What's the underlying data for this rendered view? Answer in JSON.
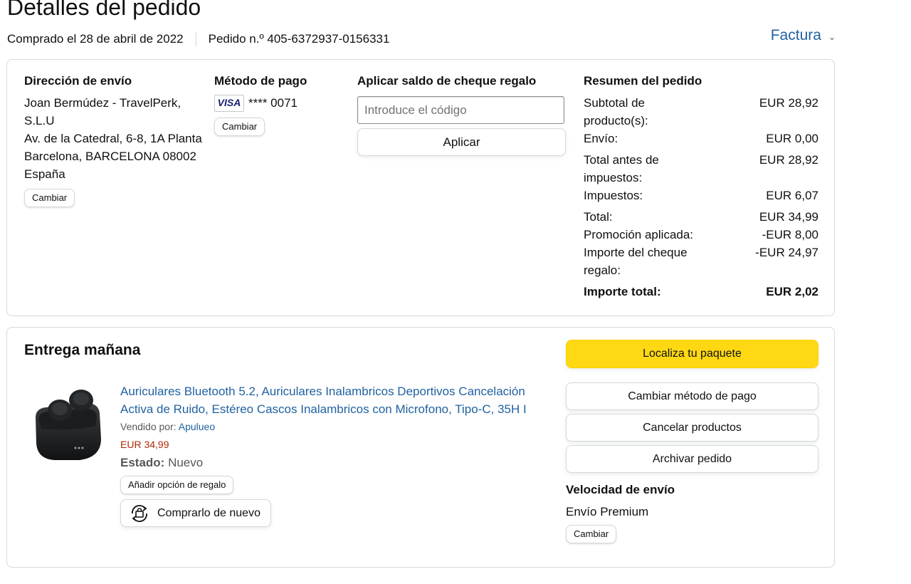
{
  "page": {
    "title": "Detalles del pedido"
  },
  "meta": {
    "purchased": "Comprado el 28 de abril de 2022",
    "order_number": "Pedido n.º 405-6372937-0156331",
    "invoice_label": "Factura"
  },
  "shipping": {
    "title": "Dirección de envío",
    "lines": [
      "Joan Bermúdez - TravelPerk, S.L.U",
      "Av. de la Catedral, 6-8, 1A Planta",
      "Barcelona, BARCELONA 08002",
      "España"
    ],
    "change_label": "Cambiar"
  },
  "payment": {
    "title": "Método de pago",
    "card_brand": "VISA",
    "card_masked": "**** 0071",
    "change_label": "Cambiar"
  },
  "gift": {
    "title": "Aplicar saldo de cheque regalo",
    "placeholder": "Introduce el código",
    "apply_label": "Aplicar"
  },
  "summary": {
    "title": "Resumen del pedido",
    "rows": [
      {
        "label": "Subtotal de producto(s):",
        "value": "EUR 28,92"
      },
      {
        "label": "Envío:",
        "value": "EUR 0,00"
      },
      {
        "label": "Total antes de impuestos:",
        "value": "EUR 28,92"
      },
      {
        "label": "Impuestos:",
        "value": "EUR 6,07"
      },
      {
        "label": "Total:",
        "value": "EUR 34,99"
      },
      {
        "label": "Promoción aplicada:",
        "value": "-EUR 8,00"
      },
      {
        "label": "Importe del cheque regalo:",
        "value": "-EUR 24,97"
      },
      {
        "label": "Importe total:",
        "value": "EUR 2,02"
      }
    ]
  },
  "delivery": {
    "title": "Entrega mañana",
    "product": {
      "name": "Auriculares Bluetooth 5.2, Auriculares Inalambricos Deportivos Cancelación Activa de Ruido, Estéreo Cascos Inalambricos con Microfono, Tipo-C, 35H I",
      "sold_by_label": "Vendido por:",
      "seller": "Apulueo",
      "price": "EUR 34,99",
      "state_label": "Estado:",
      "state_value": "Nuevo",
      "gift_option_label": "Añadir opción de regalo",
      "buy_again_label": "Comprarlo de nuevo"
    },
    "actions": {
      "track": "Localiza tu paquete",
      "change_payment": "Cambiar método de pago",
      "cancel": "Cancelar productos",
      "archive": "Archivar pedido"
    },
    "shipping_speed": {
      "title": "Velocidad de envío",
      "value": "Envío Premium",
      "change_label": "Cambiar"
    }
  },
  "colors": {
    "link": "#2162a1",
    "price": "#b12704",
    "yellow_button": "#ffd814",
    "border": "#d5d9d9",
    "visa": "#1a1f71"
  },
  "icons": [
    "chevron-down-icon",
    "visa-card-icon",
    "earbuds-product-image",
    "buy-again-icon"
  ]
}
